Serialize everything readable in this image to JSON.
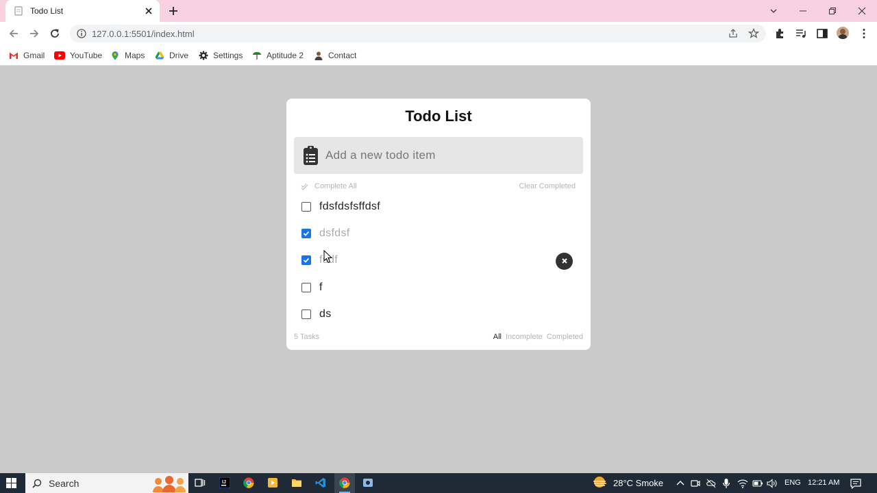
{
  "browser": {
    "tab_title": "Todo List",
    "url": "127.0.0.1:5501/index.html",
    "bookmarks": [
      {
        "label": "Gmail",
        "icon": "gmail-icon"
      },
      {
        "label": "YouTube",
        "icon": "youtube-icon"
      },
      {
        "label": "Maps",
        "icon": "maps-icon"
      },
      {
        "label": "Drive",
        "icon": "drive-icon"
      },
      {
        "label": "Settings",
        "icon": "gear-icon"
      },
      {
        "label": "Aptitude 2",
        "icon": "aptitude-icon"
      },
      {
        "label": "Contact",
        "icon": "contact-icon"
      }
    ]
  },
  "app": {
    "title": "Todo List",
    "input_placeholder": "Add a new todo item",
    "complete_all_label": "Complete All",
    "clear_completed_label": "Clear Completed",
    "todos": [
      {
        "text": "fdsfdsfsffdsf",
        "completed": false
      },
      {
        "text": "dsfdsf",
        "completed": true
      },
      {
        "text": "fsdf",
        "completed": true
      },
      {
        "text": "f",
        "completed": false
      },
      {
        "text": "ds",
        "completed": false
      }
    ],
    "task_count": "5 Tasks",
    "filters": [
      {
        "label": "All",
        "active": true
      },
      {
        "label": "Incomplete",
        "active": false
      },
      {
        "label": "Completed",
        "active": false
      }
    ],
    "colors": {
      "accent": "#1a73e8",
      "background": "#cacaca"
    }
  },
  "taskbar": {
    "search_label": "Search",
    "weather": "28°C Smoke",
    "language": "ENG",
    "time": "12:21 AM"
  }
}
